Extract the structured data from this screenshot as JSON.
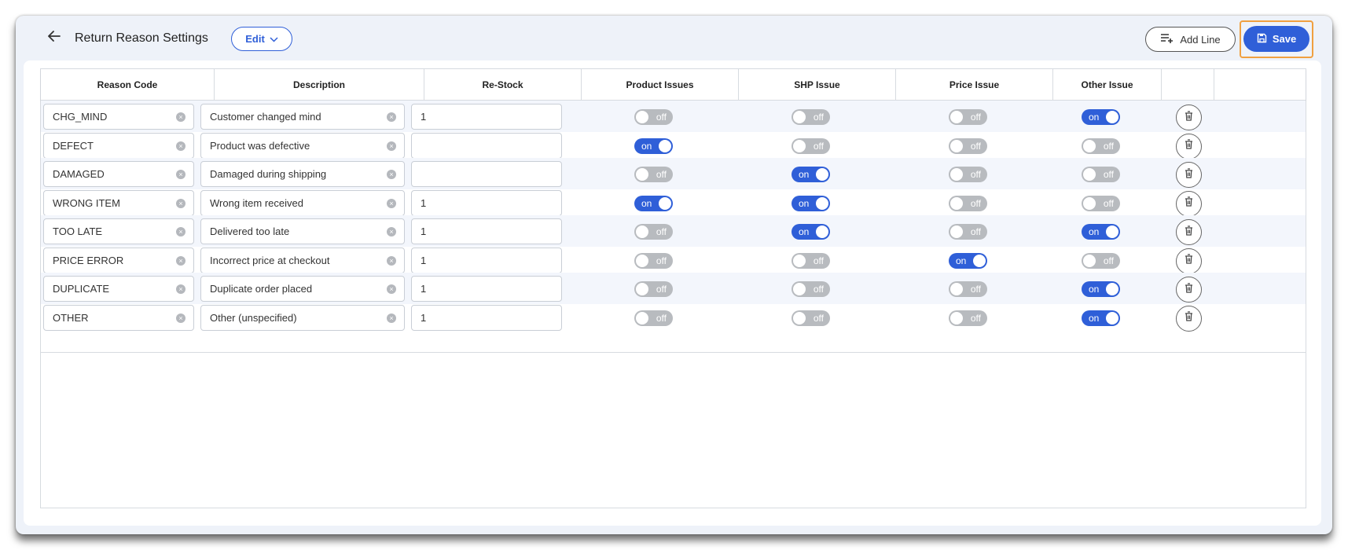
{
  "header": {
    "title": "Return Reason Settings",
    "edit_label": "Edit",
    "add_line_label": "Add Line",
    "save_label": "Save"
  },
  "table": {
    "columns": [
      "Reason Code",
      "Description",
      "Re-Stock",
      "Product Issues",
      "SHP Issue",
      "Price Issue",
      "Other Issue",
      ""
    ],
    "rows": [
      {
        "code": "CHG_MIND",
        "description": "Customer changed mind",
        "restock": "1",
        "product": "off",
        "shp": "off",
        "price": "off",
        "other": "on"
      },
      {
        "code": "DEFECT",
        "description": "Product was defective",
        "restock": "",
        "product": "on",
        "shp": "off",
        "price": "off",
        "other": "off"
      },
      {
        "code": "DAMAGED",
        "description": "Damaged during shipping",
        "restock": "",
        "product": "off",
        "shp": "on",
        "price": "off",
        "other": "off"
      },
      {
        "code": "WRONG ITEM",
        "description": "Wrong item received",
        "restock": "1",
        "product": "on",
        "shp": "on",
        "price": "off",
        "other": "off"
      },
      {
        "code": "TOO LATE",
        "description": "Delivered too late",
        "restock": "1",
        "product": "off",
        "shp": "on",
        "price": "off",
        "other": "on"
      },
      {
        "code": "PRICE ERROR",
        "description": "Incorrect price at checkout",
        "restock": "1",
        "product": "off",
        "shp": "off",
        "price": "on",
        "other": "off"
      },
      {
        "code": "DUPLICATE",
        "description": "Duplicate order placed",
        "restock": "1",
        "product": "off",
        "shp": "off",
        "price": "off",
        "other": "on"
      },
      {
        "code": "OTHER",
        "description": "Other (unspecified)",
        "restock": "1",
        "product": "off",
        "shp": "off",
        "price": "off",
        "other": "on"
      }
    ]
  },
  "colors": {
    "accent": "#2f5fd8",
    "toggle_off": "#b8bbbf",
    "focus_outline": "#f0a040",
    "row_alt": "#f3f6fc"
  },
  "icons": {
    "back": "arrow-left-icon",
    "edit_caret": "chevron-down-icon",
    "add_line": "playlist-add-icon",
    "save": "floppy-disk-icon",
    "clear": "clear-circle-icon",
    "delete": "trash-icon"
  }
}
